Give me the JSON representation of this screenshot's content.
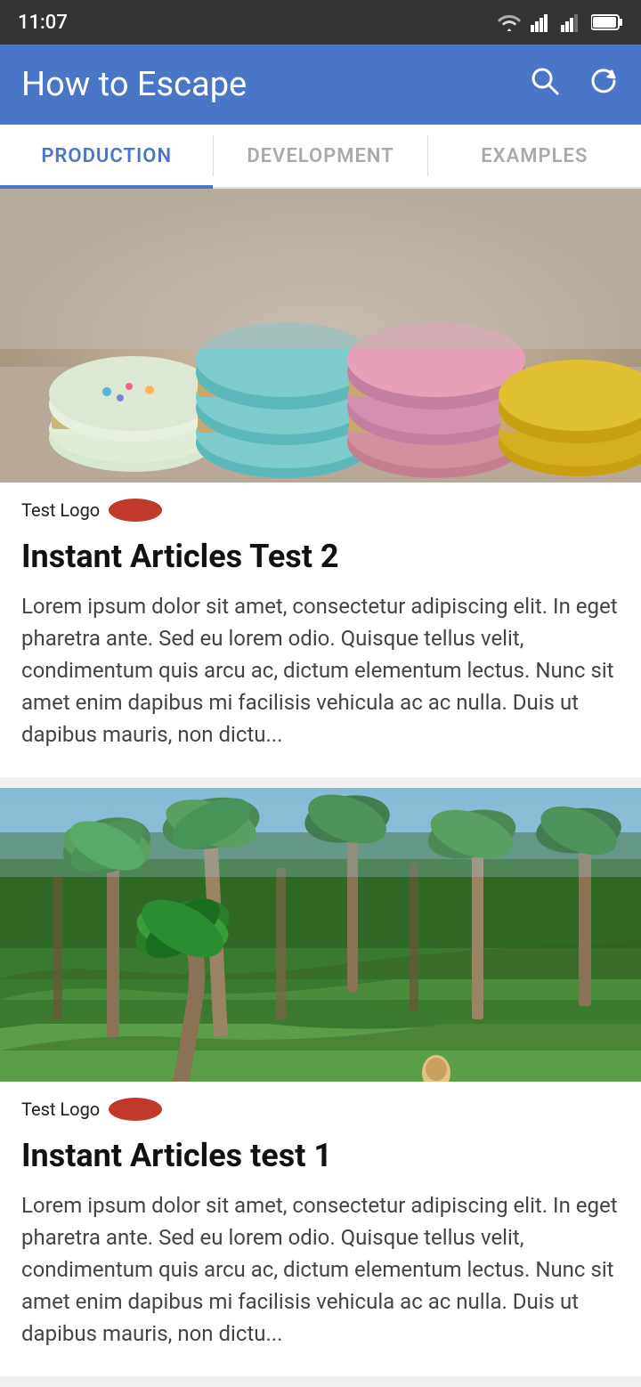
{
  "statusBar": {
    "time": "11:07",
    "wifi": "wifi",
    "signal1": "signal",
    "signal2": "signal",
    "battery": "battery"
  },
  "appBar": {
    "title": "How to Escape",
    "searchIcon": "search",
    "refreshIcon": "refresh"
  },
  "tabs": [
    {
      "id": "production",
      "label": "PRODUCTION",
      "active": true
    },
    {
      "id": "development",
      "label": "DEVELOPMENT",
      "active": false
    },
    {
      "id": "examples",
      "label": "EXAMPLES",
      "active": false
    }
  ],
  "articles": [
    {
      "id": "article-2",
      "imageType": "macarons",
      "logoText": "Test Logo",
      "title": "Instant Articles Test 2",
      "excerpt": "Lorem ipsum dolor sit amet, consectetur adipiscing elit. In eget pharetra ante. Sed eu lorem odio. Quisque tellus velit, condimentum quis arcu ac, dictum elementum lectus. Nunc sit amet enim dapibus mi facilisis vehicula ac ac nulla. Duis ut dapibus mauris, non dictu..."
    },
    {
      "id": "article-1",
      "imageType": "terraces",
      "logoText": "Test Logo",
      "title": "Instant Articles test 1",
      "excerpt": "Lorem ipsum dolor sit amet, consectetur adipiscing elit. In eget pharetra ante. Sed eu lorem odio. Quisque tellus velit, condimentum quis arcu ac, dictum elementum lectus. Nunc sit amet enim dapibus mi facilisis vehicula ac ac nulla. Duis ut dapibus mauris, non dictu..."
    }
  ]
}
